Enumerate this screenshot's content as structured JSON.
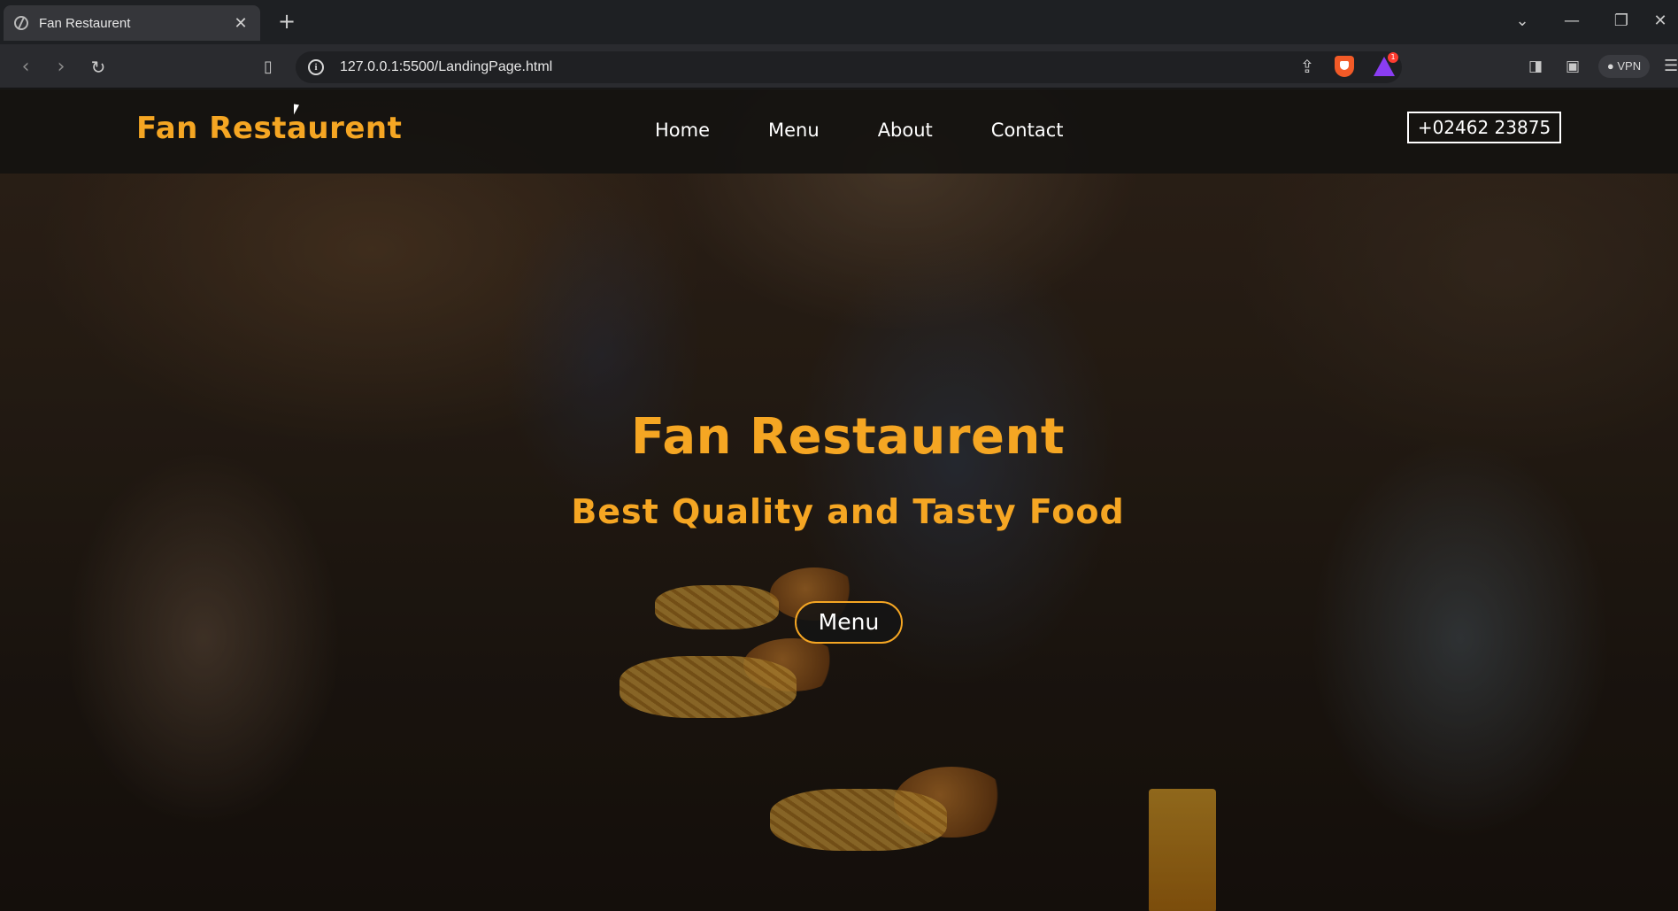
{
  "browser": {
    "tab_title": "Fan Restaurent",
    "tab_close": "✕",
    "new_tab": "+",
    "url": "127.0.0.1:5500/LandingPage.html",
    "vpn_label": "VPN",
    "rewards_count": "1"
  },
  "navbar": {
    "logo": "Fan Restaurent",
    "links": [
      "Home",
      "Menu",
      "About",
      "Contact"
    ],
    "phone": "+02462 23875"
  },
  "hero": {
    "title": "Fan Restaurent",
    "subtitle": "Best Quality and Tasty Food",
    "button_label": "Menu"
  },
  "colors": {
    "accent": "#f5a623",
    "navbar_bg": "#141210"
  }
}
